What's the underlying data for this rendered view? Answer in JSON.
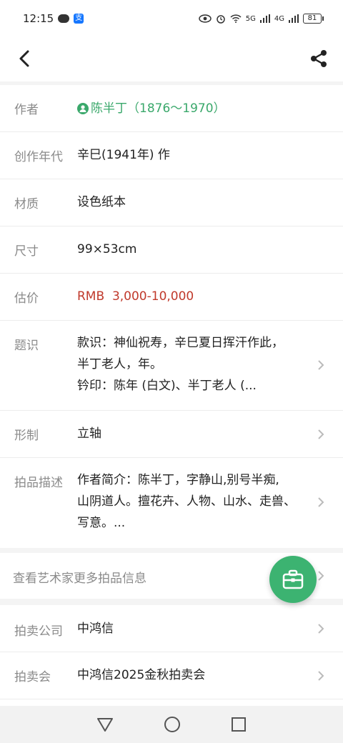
{
  "status_bar": {
    "time": "12:15",
    "alipay_glyph": "支",
    "battery": "81",
    "signal_labels": [
      "5G",
      "4G"
    ]
  },
  "nav": {
    "back_icon": "chevron-left-icon",
    "share_icon": "share-icon"
  },
  "details": [
    {
      "label": "作者",
      "value": "陈半丁（1876～1970）"
    },
    {
      "label": "创作年代",
      "value": "辛巳(1941年) 作"
    },
    {
      "label": "材质",
      "value": "设色纸本"
    },
    {
      "label": "尺寸",
      "value": "99×53cm"
    },
    {
      "label": "估价",
      "value": "RMB  3,000-10,000"
    },
    {
      "label": "题识",
      "lines": [
        "款识：神仙祝寿，辛巳夏日挥汗作此，",
        "半丁老人，年。",
        "钤印：陈年 (白文)、半丁老人 (..."
      ]
    },
    {
      "label": "形制",
      "value": "立轴"
    },
    {
      "label": "拍品描述",
      "lines": [
        "作者简介：陈半丁，字静山,别号半痴,",
        "山阴道人。擅花卉、人物、山水、走兽、",
        "写意。..."
      ]
    }
  ],
  "more_artist": {
    "label": "查看艺术家更多拍品信息"
  },
  "auction": [
    {
      "label": "拍卖公司",
      "value": "中鸿信"
    },
    {
      "label": "拍卖会",
      "value": "中鸿信2025金秋拍卖会"
    }
  ],
  "colors": {
    "accent_green": "#3cb371",
    "author_green": "#3aa86b",
    "estimate_red": "#c0392b"
  }
}
